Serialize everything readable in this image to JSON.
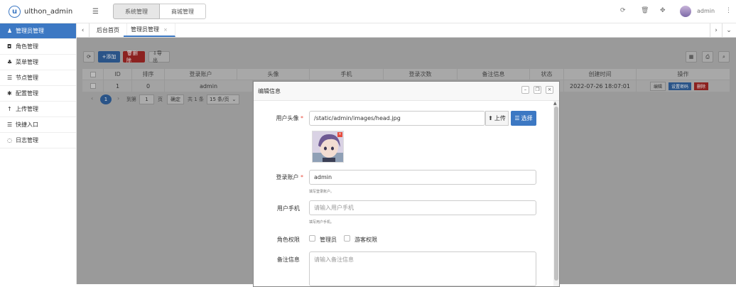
{
  "header": {
    "app_title": "ulthon_admin",
    "menu_toggle_glyph": "☰",
    "top_tabs": [
      "系统管理",
      "商城管理"
    ],
    "user_name": "admin"
  },
  "sidebar": {
    "items": [
      {
        "label": "管理员管理",
        "icon": "user-icon",
        "glyph": "♟",
        "active": true
      },
      {
        "label": "角色管理",
        "icon": "role-icon",
        "glyph": "◘"
      },
      {
        "label": "菜单管理",
        "icon": "tree-icon",
        "glyph": "♣"
      },
      {
        "label": "节点管理",
        "icon": "list-icon",
        "glyph": "☰"
      },
      {
        "label": "配置管理",
        "icon": "gear-icon",
        "glyph": "✱"
      },
      {
        "label": "上传管理",
        "icon": "upload-icon",
        "glyph": "↑"
      },
      {
        "label": "快捷入口",
        "icon": "list-icon",
        "glyph": "☰"
      },
      {
        "label": "日志管理",
        "icon": "log-icon",
        "glyph": "◌"
      }
    ]
  },
  "page_tabs": [
    "后台首页",
    "管理员管理"
  ],
  "toolbar": {
    "refresh_glyph": "⟳",
    "add_label": "+添加",
    "delete_label": "🗑删除",
    "export_label": "⇩导出"
  },
  "table": {
    "columns": [
      "ID",
      "排序",
      "登录账户",
      "头像",
      "手机",
      "登录次数",
      "备注信息",
      "状态",
      "创建时间",
      "操作"
    ],
    "row": {
      "id": "1",
      "sort": "0",
      "username": "admin",
      "created": "2022-07-26 18:07:01"
    },
    "row_actions": [
      "编辑",
      "设置密码",
      "删除"
    ],
    "pager": {
      "page": "1",
      "goto_label": "到第",
      "goto_value": "1",
      "page_unit": "页",
      "confirm": "确定",
      "total": "共 1 条",
      "per_page": "15 条/页"
    }
  },
  "modal": {
    "title": "编辑信息",
    "fields": {
      "avatar": {
        "label": "用户头像",
        "value": "/static/admin/images/head.jpg",
        "upload_label": "上传",
        "choose_label": "选择"
      },
      "username": {
        "label": "登录账户",
        "value": "admin",
        "hint": "填写登录账户。"
      },
      "phone": {
        "label": "用户手机",
        "placeholder": "请输入用户手机",
        "hint": "填写用户手机。"
      },
      "roles": {
        "label": "角色权限",
        "options": [
          "管理员",
          "游客权限"
        ]
      },
      "remark": {
        "label": "备注信息",
        "placeholder": "请输入备注信息"
      }
    },
    "required_mark": "*"
  },
  "colors": {
    "accent": "#3c78c3",
    "danger": "#c9302c",
    "primary_btn": "#3c78c3"
  }
}
